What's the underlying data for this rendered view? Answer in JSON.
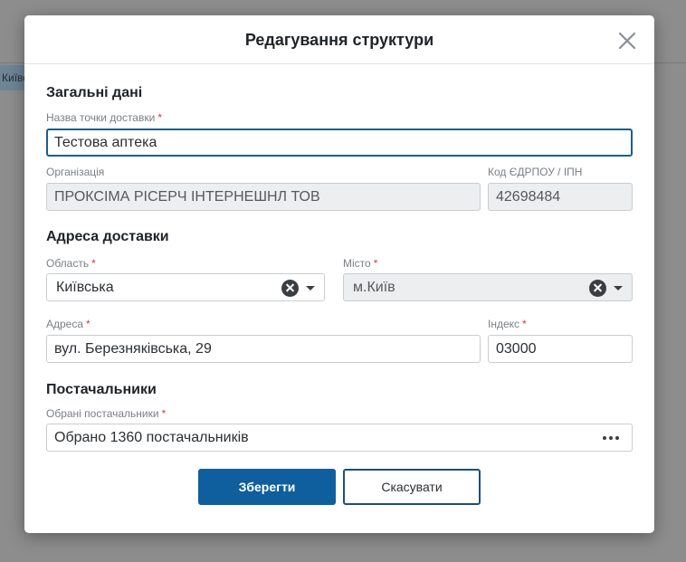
{
  "background": {
    "chip_text": "Київська"
  },
  "modal": {
    "title": "Редагування структури",
    "close_icon": "close-icon"
  },
  "general": {
    "section_title": "Загальні дані",
    "delivery_point_label": "Назва точки доставки",
    "delivery_point_value": "Тестова аптека",
    "organization_label": "Організація",
    "organization_value": "ПРОКСІМА РІСЕРЧ ІНТЕРНЕШНЛ ТОВ",
    "edrpou_label": "Код ЄДРПОУ / ІПН",
    "edrpou_value": "42698484"
  },
  "address": {
    "section_title": "Адреса доставки",
    "region_label": "Область",
    "region_value": "Київська",
    "city_label": "Місто",
    "city_value": "м.Київ",
    "street_label": "Адреса",
    "street_value": "вул. Березняківська, 29",
    "index_label": "Індекс",
    "index_value": "03000"
  },
  "suppliers": {
    "section_title": "Постачальники",
    "selected_label": "Обрані постачальники",
    "selected_value": "Обрано 1360 постачальників"
  },
  "buttons": {
    "save_label": "Зберегти",
    "cancel_label": "Скасувати"
  },
  "required_mark": "*",
  "colors": {
    "primary": "#0f5f9e",
    "required": "#d9393f",
    "focus_border": "#1d5d8c"
  }
}
